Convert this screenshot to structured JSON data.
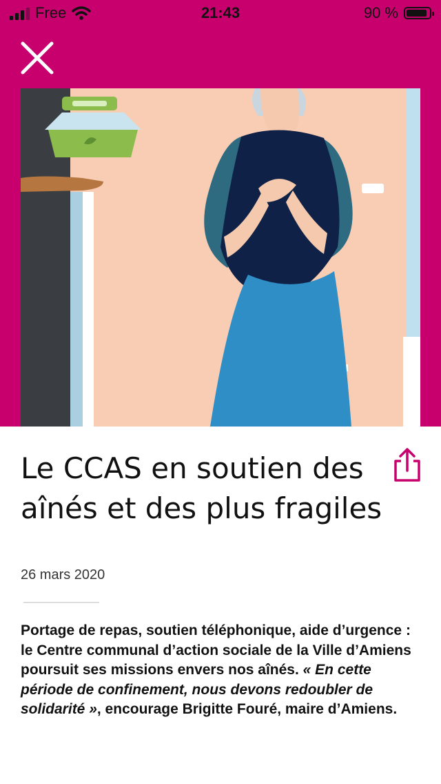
{
  "status_bar": {
    "carrier": "Free",
    "time": "21:43",
    "battery": "90 %",
    "battery_level": 0.9
  },
  "colors": {
    "brand": "#c8006e",
    "background": "#ffffff",
    "text": "#111111"
  },
  "icons": {
    "close": "close-icon",
    "share": "share-icon"
  },
  "article": {
    "title": "Le CCAS en soutien des aînés et des plus fragiles",
    "date": "26 mars 2020",
    "intro": {
      "part1": "Portage de repas, soutien téléphonique, aide d’urgence : le Centre communal d’action sociale de la Ville d’Amiens poursuit ses missions envers nos aînés. ",
      "quote": "« En cette période de confinement, nous devons redoubler de solidarité »",
      "part2": ", encourage Brigitte Fouré, maire d’Amiens."
    }
  }
}
